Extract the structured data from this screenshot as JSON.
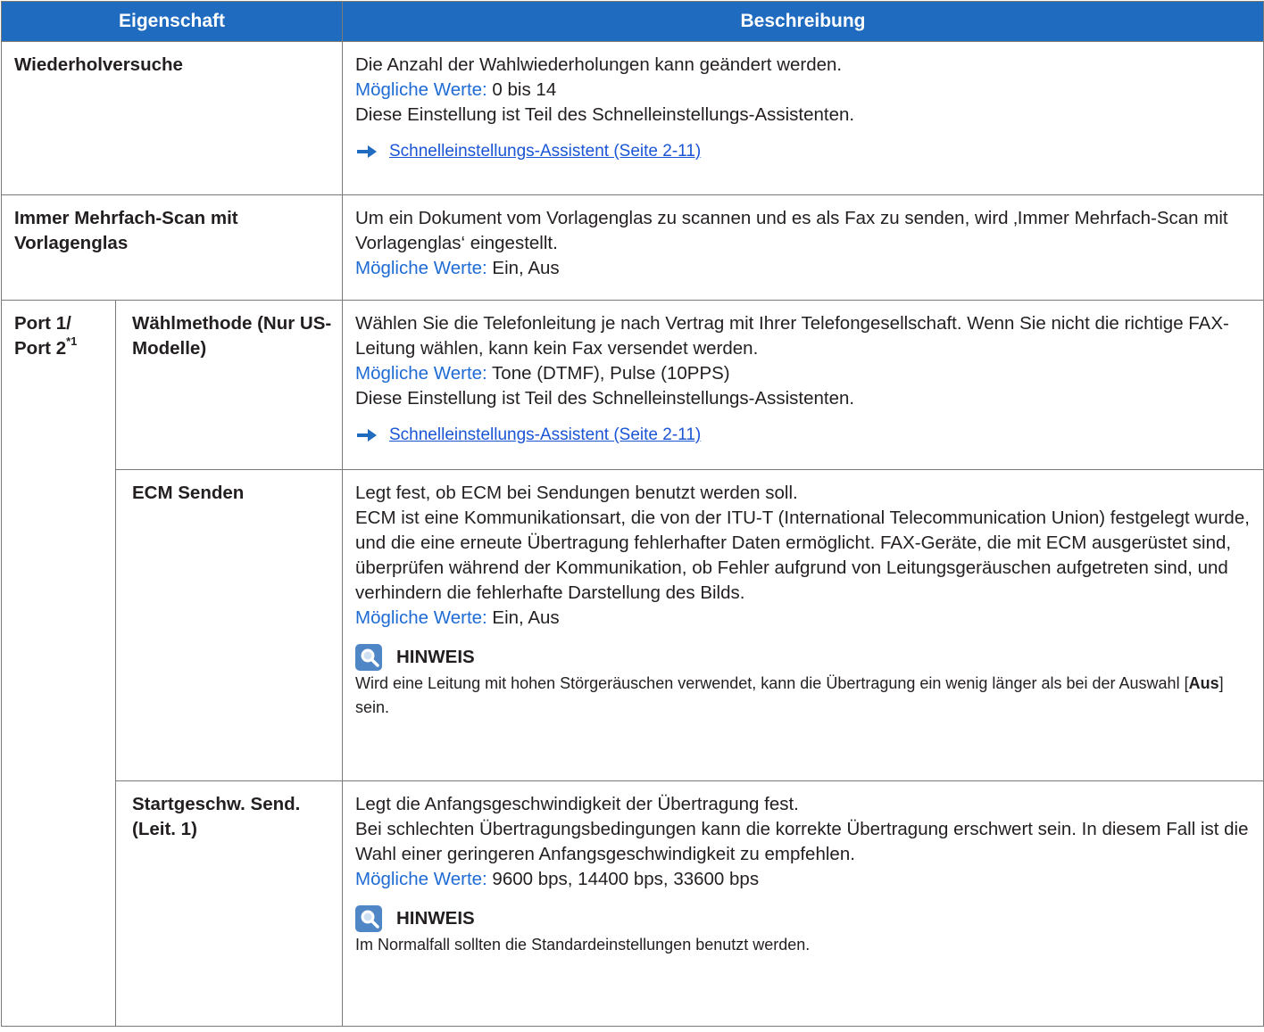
{
  "header": {
    "col1": "Eigenschaft",
    "col2": "Beschreibung"
  },
  "rows": {
    "retries": {
      "label": "Wiederholversuche",
      "lines": [
        "Die Anzahl der Wahlwiederholungen kann geändert werden."
      ],
      "values_label": "Mögliche Werte:",
      "values": " 0 bis 14",
      "after": "Diese Einstellung ist Teil des Schnelleinstellungs-Assistenten.",
      "ref": "Schnelleinstellungs-Assistent (Seite 2-11)"
    },
    "multiscan": {
      "label": "Immer Mehrfach-Scan mit Vorlagenglas",
      "line1": "Um ein Dokument vom Vorlagenglas zu scannen und es als Fax zu senden, wird ‚Immer Mehrfach-Scan mit Vorlagenglas‘ eingestellt.",
      "values_label": "Mögliche Werte:",
      "values": " Ein, Aus"
    },
    "port": {
      "label": "Port 1/ Port 2",
      "footnote": "*1",
      "dial": {
        "label": "Wählmethode (Nur US-Modelle)",
        "line1": "Wählen Sie die Telefonleitung je nach Vertrag mit Ihrer Telefongesellschaft. Wenn Sie nicht die richtige FAX-Leitung wählen, kann kein Fax versendet werden.",
        "values_label": "Mögliche Werte:",
        "values": " Tone (DTMF), Pulse (10PPS)",
        "after": "Diese Einstellung ist Teil des Schnelleinstellungs-Assistenten.",
        "ref": "Schnelleinstellungs-Assistent (Seite 2-11)"
      },
      "ecm": {
        "label": "ECM Senden",
        "line1": "Legt fest, ob ECM bei Sendungen benutzt werden soll.",
        "line2": "ECM ist eine Kommunikationsart, die von der ITU-T (International Telecommunication Union) festgelegt wurde, und die eine erneute Übertragung fehlerhafter Daten ermöglicht. FAX-Geräte, die mit ECM ausgerüstet sind, überprüfen während der Kommunikation, ob Fehler aufgrund von Leitungsgeräuschen aufgetreten sind, und verhindern die fehlerhafte Darstellung des Bilds.",
        "values_label": "Mögliche Werte:",
        "values": " Ein, Aus",
        "note_title": "HINWEIS",
        "note_pre": "Wird eine Leitung mit hohen Störgeräuschen verwendet, kann die Übertragung ein wenig länger als bei der Auswahl [",
        "note_bold": "Aus",
        "note_post": "] sein."
      },
      "speed": {
        "label": "Startgeschw. Send. (Leit. 1)",
        "line1": "Legt die Anfangsgeschwindigkeit der Übertragung fest.",
        "line2": "Bei schlechten Übertragungsbedingungen kann die korrekte Übertragung erschwert sein. In diesem Fall ist die Wahl einer geringeren Anfangsgeschwindigkeit zu empfehlen.",
        "values_label": "Mögliche Werte:",
        "values": " 9600 bps, 14400 bps, 33600 bps",
        "note_title": "HINWEIS",
        "note_text": "Im Normalfall sollten die Standardeinstellungen benutzt werden."
      }
    }
  },
  "colors": {
    "header_bg": "#1f6bc0",
    "value_label": "#1f6bd6",
    "link": "#1a55d6"
  },
  "icons": {
    "ref_arrow": "arrow-right-icon",
    "note": "lightbulb-magnifier-icon"
  }
}
